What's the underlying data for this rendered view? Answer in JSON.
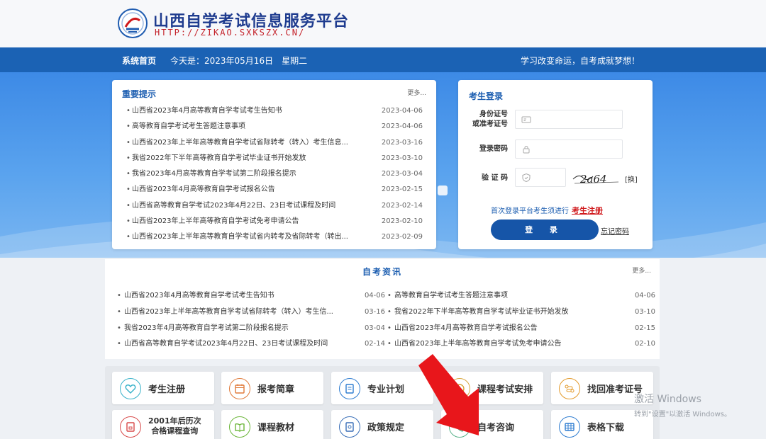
{
  "header": {
    "title": "山西自学考试信息服务平台",
    "url": "HTTP://ZIKAO.SXKSZX.CN/"
  },
  "navbar": {
    "home": "系统首页",
    "date": "今天是：2023年05月16日　星期二",
    "slogan": "学习改变命运，自考成就梦想！"
  },
  "notices": {
    "title": "重要提示",
    "more": "更多...",
    "items": [
      {
        "title": "山西省2023年4月高等教育自学考试考生告知书",
        "date": "2023-04-06"
      },
      {
        "title": "高等教育自学考试考生答题注意事项",
        "date": "2023-04-06"
      },
      {
        "title": "山西省2023年上半年高等教育自学考试省际转考（转入）考生信息...",
        "date": "2023-03-16"
      },
      {
        "title": "我省2022年下半年高等教育自学考试毕业证书开始发放",
        "date": "2023-03-10"
      },
      {
        "title": "我省2023年4月高等教育自学考试第二阶段报名提示",
        "date": "2023-03-04"
      },
      {
        "title": "山西省2023年4月高等教育自学考试报名公告",
        "date": "2023-02-15"
      },
      {
        "title": "山西省高等教育自学考试2023年4月22日、23日考试课程及时间",
        "date": "2023-02-14"
      },
      {
        "title": "山西省2023年上半年高等教育自学考试免考申请公告",
        "date": "2023-02-10"
      },
      {
        "title": "山西省2023年上半年高等教育自学考试省内转考及省际转考（转出...",
        "date": "2023-02-09"
      }
    ]
  },
  "login": {
    "title": "考生登录",
    "id_label_1": "身份证号",
    "id_label_2": "或准考证号",
    "password_label": "登录密码",
    "captcha_label": "验 证 码",
    "captcha_text": "2a64",
    "captcha_switch": "[换]",
    "first_login_text": "首次登录平台考生须进行",
    "register_link": "考生注册",
    "login_button": "登 录",
    "forgot_link": "忘记密码"
  },
  "news": {
    "title": "自考资讯",
    "more": "更多...",
    "left": [
      {
        "title": "山西省2023年4月高等教育自学考试考生告知书",
        "date": "04-06"
      },
      {
        "title": "山西省2023年上半年高等教育自学考试省际转考（转入）考生信...",
        "date": "03-16"
      },
      {
        "title": "我省2023年4月高等教育自学考试第二阶段报名提示",
        "date": "03-04"
      },
      {
        "title": "山西省高等教育自学考试2023年4月22日、23日考试课程及时间",
        "date": "02-14"
      }
    ],
    "right": [
      {
        "title": "高等教育自学考试考生答题注意事项",
        "date": "04-06"
      },
      {
        "title": "我省2022年下半年高等教育自学考试毕业证书开始发放",
        "date": "03-10"
      },
      {
        "title": "山西省2023年4月高等教育自学考试报名公告",
        "date": "02-15"
      },
      {
        "title": "山西省2023年上半年高等教育自学考试免考申请公告",
        "date": "02-10"
      }
    ]
  },
  "tiles": {
    "register": "考生注册",
    "guide": "报考简章",
    "major": "专业计划",
    "schedule": "课程考试安排",
    "retrieve": "找回准考证号",
    "history_1": "2001年后历次",
    "history_2": "合格课程查询",
    "textbook": "课程教材",
    "policy": "政策规定",
    "consult": "自考咨询",
    "forms": "表格下载"
  },
  "watermark": {
    "line1": "激活 Windows",
    "line2": "转到\"设置\"以激活 Windows。"
  },
  "colors": {
    "brand_blue": "#1b62b4",
    "accent_red": "#d0191c",
    "arrow_red": "#e8161b"
  }
}
